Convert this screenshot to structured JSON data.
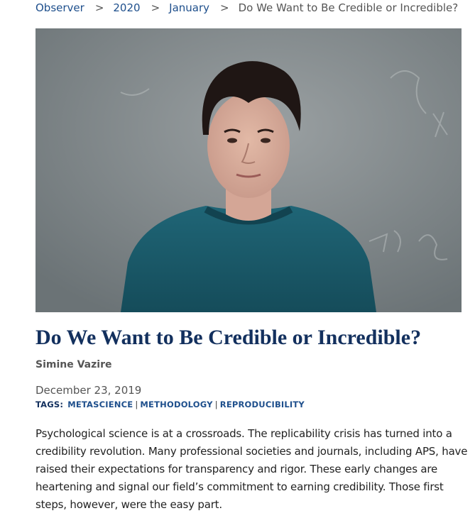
{
  "breadcrumb": {
    "items": [
      "Observer",
      "2020",
      "January"
    ],
    "separator": ">",
    "current": "Do We Want to Be Credible or Incredible?"
  },
  "hero": {
    "alt": "portrait photo of author in teal sweater in front of chalkboard"
  },
  "article": {
    "title": "Do We Want to Be Credible or Incredible?",
    "author": "Simine Vazire",
    "date": "December 23, 2019",
    "tags_label": "TAGS:",
    "tags": [
      "METASCIENCE",
      "METHODOLOGY",
      "REPRODUCIBILITY"
    ],
    "paragraph": "Psychological science is at a crossroads. The replicability crisis has turned into a credibility revolution. Many professional societies and journals, including APS, have raised their expectations for transparency and rigor. These early changes are heartening and signal our field’s commitment to earning credibility. Those first steps, however, were the easy part."
  },
  "colors": {
    "link": "#1e4f8c",
    "title": "#13305e",
    "sweater": "#1b5a6a",
    "background_board": "#7e8588"
  }
}
